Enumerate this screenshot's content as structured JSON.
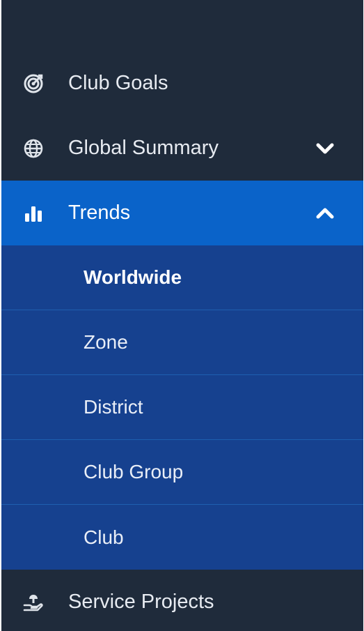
{
  "nav": {
    "items": [
      {
        "label": "Club Goals",
        "icon": "target-icon"
      },
      {
        "label": "Global Summary",
        "icon": "globe-icon",
        "expandable": true,
        "expanded": false
      },
      {
        "label": "Trends",
        "icon": "bar-chart-icon",
        "expandable": true,
        "expanded": true,
        "active": true
      },
      {
        "label": "Service Projects",
        "icon": "helping-hand-icon"
      }
    ],
    "trends_submenu": [
      {
        "label": "Worldwide",
        "selected": true
      },
      {
        "label": "Zone"
      },
      {
        "label": "District"
      },
      {
        "label": "Club Group"
      },
      {
        "label": "Club"
      }
    ]
  },
  "colors": {
    "sidebar_bg": "#1f2b3b",
    "active_bg": "#0a63c9",
    "submenu_bg": "#16418f"
  }
}
